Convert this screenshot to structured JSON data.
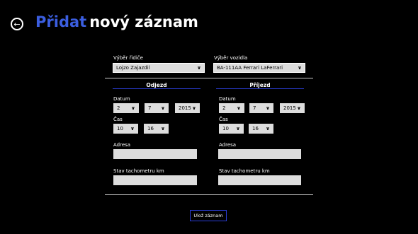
{
  "header": {
    "back_icon": "back-arrow-icon",
    "title_accent": "Přidat",
    "title_rest": "nový záznam"
  },
  "driver": {
    "label": "Výběr řidiče",
    "value": "Lojzo Zajazdil"
  },
  "vehicle": {
    "label": "Výběr vozidla",
    "value": "BA-111AA Ferrari LaFerrari"
  },
  "departure": {
    "heading": "Odjezd",
    "date_label": "Datum",
    "day": "2",
    "month": "7",
    "year": "2015",
    "time_label": "Čas",
    "hour": "10",
    "minute": "16",
    "address_label": "Adresa",
    "address_value": "",
    "odometer_label": "Stav tachometru km",
    "odometer_value": ""
  },
  "arrival": {
    "heading": "Příjezd",
    "date_label": "Datum",
    "day": "2",
    "month": "7",
    "year": "2015",
    "time_label": "Čas",
    "hour": "10",
    "minute": "16",
    "address_label": "Adresa",
    "address_value": "",
    "odometer_label": "Stav tachometru km",
    "odometer_value": ""
  },
  "save_button": "Ulož záznam",
  "colors": {
    "accent": "#3b5ee0",
    "underline": "#2a3dd6",
    "field_bg": "#dddddd",
    "background": "#000000"
  }
}
